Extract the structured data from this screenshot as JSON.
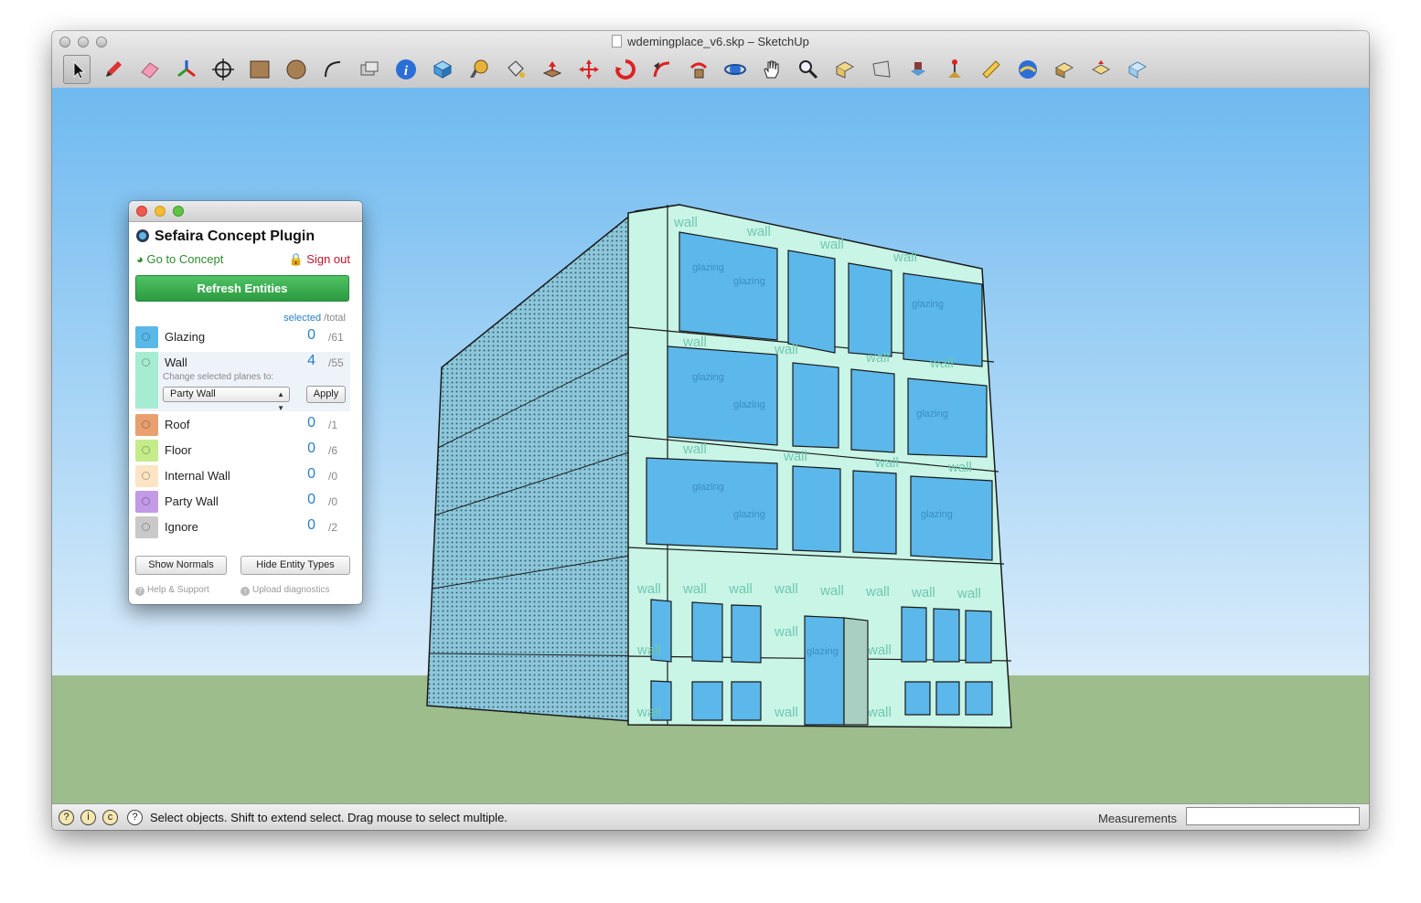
{
  "window": {
    "title": "wdemingplace_v6.skp – SketchUp"
  },
  "toolbar": {
    "tools": [
      {
        "name": "select-tool",
        "icon": "arrow-cursor-icon"
      },
      {
        "name": "pencil-tool",
        "icon": "pencil-icon"
      },
      {
        "name": "eraser-tool",
        "icon": "eraser-icon"
      },
      {
        "name": "axes-tool",
        "icon": "axes-icon"
      },
      {
        "name": "position-camera-tool",
        "icon": "crosshair-icon"
      },
      {
        "name": "rectangle-tool",
        "icon": "rectangle-icon"
      },
      {
        "name": "circle-tool",
        "icon": "circle-icon"
      },
      {
        "name": "arc-tool",
        "icon": "arc-icon"
      },
      {
        "name": "section-plane-tool",
        "icon": "section-icon"
      },
      {
        "name": "model-info-tool",
        "icon": "info-icon"
      },
      {
        "name": "components-tool",
        "icon": "box-icon"
      },
      {
        "name": "tape-measure-tool",
        "icon": "tape-icon"
      },
      {
        "name": "paint-bucket-tool",
        "icon": "paint-bucket-icon"
      },
      {
        "name": "push-pull-tool",
        "icon": "push-pull-icon"
      },
      {
        "name": "move-tool",
        "icon": "move-icon"
      },
      {
        "name": "rotate-tool",
        "icon": "rotate-icon"
      },
      {
        "name": "follow-me-tool",
        "icon": "follow-me-icon"
      },
      {
        "name": "scale-tool",
        "icon": "scale-icon"
      },
      {
        "name": "orbit-tool",
        "icon": "orbit-icon"
      },
      {
        "name": "pan-tool",
        "icon": "hand-icon"
      },
      {
        "name": "zoom-tool",
        "icon": "magnifier-icon"
      },
      {
        "name": "zoom-extents-tool",
        "icon": "zoom-extents-icon"
      },
      {
        "name": "previous-view-tool",
        "icon": "previous-icon"
      },
      {
        "name": "add-location-tool",
        "icon": "location-icon"
      },
      {
        "name": "walk-tool",
        "icon": "walk-icon"
      },
      {
        "name": "dimension-tool",
        "icon": "ruler-icon"
      },
      {
        "name": "warehouse-tool",
        "icon": "warehouse-icon"
      },
      {
        "name": "share-model-tool",
        "icon": "share-icon"
      },
      {
        "name": "extension-tool",
        "icon": "extension-icon"
      },
      {
        "name": "layout-tool",
        "icon": "layout-icon"
      }
    ],
    "colors": {
      "active": "#bdbdbd"
    }
  },
  "status": {
    "text": "Select objects. Shift to extend select. Drag mouse to select multiple.",
    "measurements_label": "Measurements",
    "measurements_value": ""
  },
  "plugin": {
    "title": "Sefaira Concept Plugin",
    "go_to_concept": "Go to Concept",
    "sign_out": "Sign out",
    "refresh": "Refresh Entities",
    "header_selected": "selected",
    "header_total": "/total",
    "change_label": "Change selected planes to:",
    "select_value": "Party Wall",
    "apply": "Apply",
    "show_normals": "Show Normals",
    "hide_entity_types": "Hide Entity Types",
    "help": "Help & Support",
    "upload": "Upload diagnostics",
    "entities": [
      {
        "label": "Glazing",
        "selected": "0",
        "total": "/61",
        "color": "#5ab8e8"
      },
      {
        "label": "Wall",
        "selected": "4",
        "total": "/55",
        "color": "#a6ecd2"
      },
      {
        "label": "Roof",
        "selected": "0",
        "total": "/1",
        "color": "#e9a070"
      },
      {
        "label": "Floor",
        "selected": "0",
        "total": "/6",
        "color": "#c5ec8a"
      },
      {
        "label": "Internal Wall",
        "selected": "0",
        "total": "/0",
        "color": "#fde4c4"
      },
      {
        "label": "Party Wall",
        "selected": "0",
        "total": "/0",
        "color": "#c29ae8"
      },
      {
        "label": "Ignore",
        "selected": "0",
        "total": "/2",
        "color": "#c9c9c9"
      }
    ]
  },
  "model": {
    "wall_text": "wall",
    "glazing_text": "glazing",
    "colors": {
      "sky_top": "#6fbaf0",
      "sky_bottom": "#d9ecfa",
      "ground": "#9dbd8c",
      "wall": "#c9f5e6",
      "glazing": "#5cb7ea"
    }
  }
}
